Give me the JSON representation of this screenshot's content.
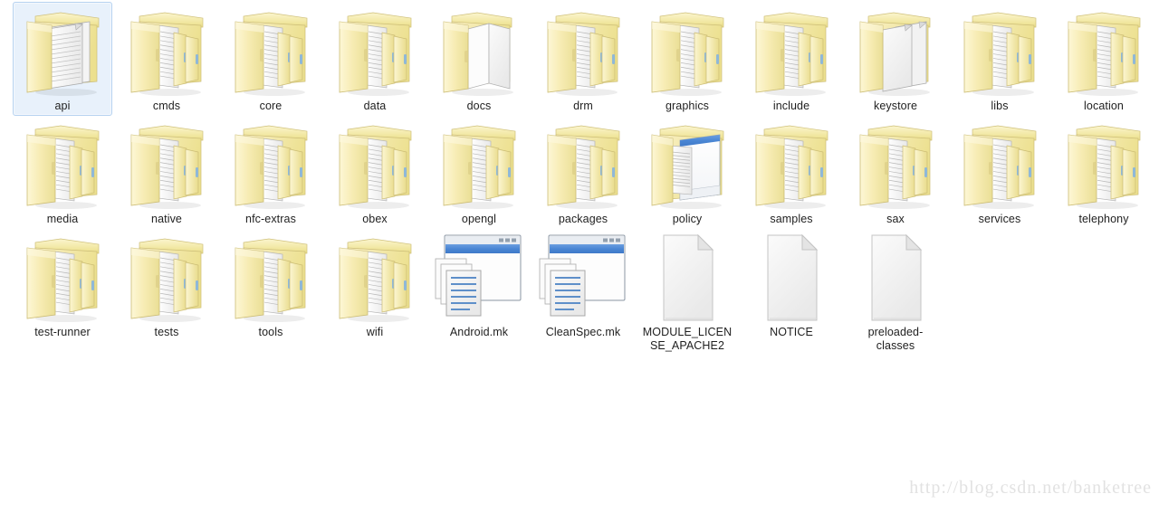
{
  "view": {
    "background_color": "#ffffff",
    "label_color": "#1f1f1f",
    "selection_fill": "#e8f1fb",
    "selection_border": "#b6d2f0",
    "folder_color": "#f4e8a8",
    "columns": 11,
    "column_spacing": 115,
    "row_spacing": 125
  },
  "watermark": {
    "text": "http://blog.csdn.net/banketree",
    "color": "#e2e2e2"
  },
  "items": [
    {
      "name": "api",
      "icon": "folder-open-document-icon",
      "selected": true,
      "col": 0,
      "row": 0
    },
    {
      "name": "cmds",
      "icon": "folder-open-icon",
      "selected": false,
      "col": 1,
      "row": 0
    },
    {
      "name": "core",
      "icon": "folder-open-icon",
      "selected": false,
      "col": 2,
      "row": 0
    },
    {
      "name": "data",
      "icon": "folder-open-icon",
      "selected": false,
      "col": 3,
      "row": 0
    },
    {
      "name": "docs",
      "icon": "folder-open-blank-pages-icon",
      "selected": false,
      "col": 4,
      "row": 0
    },
    {
      "name": "drm",
      "icon": "folder-open-icon",
      "selected": false,
      "col": 5,
      "row": 0
    },
    {
      "name": "graphics",
      "icon": "folder-open-icon",
      "selected": false,
      "col": 6,
      "row": 0
    },
    {
      "name": "include",
      "icon": "folder-open-icon",
      "selected": false,
      "col": 7,
      "row": 0
    },
    {
      "name": "keystore",
      "icon": "folder-open-two-pages-icon",
      "selected": false,
      "col": 8,
      "row": 0
    },
    {
      "name": "libs",
      "icon": "folder-open-icon",
      "selected": false,
      "col": 9,
      "row": 0
    },
    {
      "name": "location",
      "icon": "folder-open-icon",
      "selected": false,
      "col": 10,
      "row": 0
    },
    {
      "name": "media",
      "icon": "folder-open-icon",
      "selected": false,
      "col": 0,
      "row": 1
    },
    {
      "name": "native",
      "icon": "folder-open-icon",
      "selected": false,
      "col": 1,
      "row": 1
    },
    {
      "name": "nfc-extras",
      "icon": "folder-open-icon",
      "selected": false,
      "col": 2,
      "row": 1
    },
    {
      "name": "obex",
      "icon": "folder-open-icon",
      "selected": false,
      "col": 3,
      "row": 1
    },
    {
      "name": "opengl",
      "icon": "folder-open-icon",
      "selected": false,
      "col": 4,
      "row": 1
    },
    {
      "name": "packages",
      "icon": "folder-open-icon",
      "selected": false,
      "col": 5,
      "row": 1
    },
    {
      "name": "policy",
      "icon": "folder-open-window-icon",
      "selected": false,
      "col": 6,
      "row": 1
    },
    {
      "name": "samples",
      "icon": "folder-open-icon",
      "selected": false,
      "col": 7,
      "row": 1
    },
    {
      "name": "sax",
      "icon": "folder-open-icon",
      "selected": false,
      "col": 8,
      "row": 1
    },
    {
      "name": "services",
      "icon": "folder-open-icon",
      "selected": false,
      "col": 9,
      "row": 1
    },
    {
      "name": "telephony",
      "icon": "folder-open-icon",
      "selected": false,
      "col": 10,
      "row": 1
    },
    {
      "name": "test-runner",
      "icon": "folder-open-icon",
      "selected": false,
      "col": 0,
      "row": 2
    },
    {
      "name": "tests",
      "icon": "folder-open-icon",
      "selected": false,
      "col": 1,
      "row": 2
    },
    {
      "name": "tools",
      "icon": "folder-open-icon",
      "selected": false,
      "col": 2,
      "row": 2
    },
    {
      "name": "wifi",
      "icon": "folder-open-icon",
      "selected": false,
      "col": 3,
      "row": 2
    },
    {
      "name": "Android.mk",
      "icon": "makefile-window-icon",
      "selected": false,
      "col": 4,
      "row": 2
    },
    {
      "name": "CleanSpec.mk",
      "icon": "makefile-window-icon",
      "selected": false,
      "col": 5,
      "row": 2
    },
    {
      "name": "MODULE_LICENSE_APACHE2",
      "icon": "blank-document-icon",
      "selected": false,
      "col": 6,
      "row": 2
    },
    {
      "name": "NOTICE",
      "icon": "blank-document-icon",
      "selected": false,
      "col": 7,
      "row": 2
    },
    {
      "name": "preloaded-classes",
      "icon": "blank-document-icon",
      "selected": false,
      "col": 8,
      "row": 2
    }
  ]
}
